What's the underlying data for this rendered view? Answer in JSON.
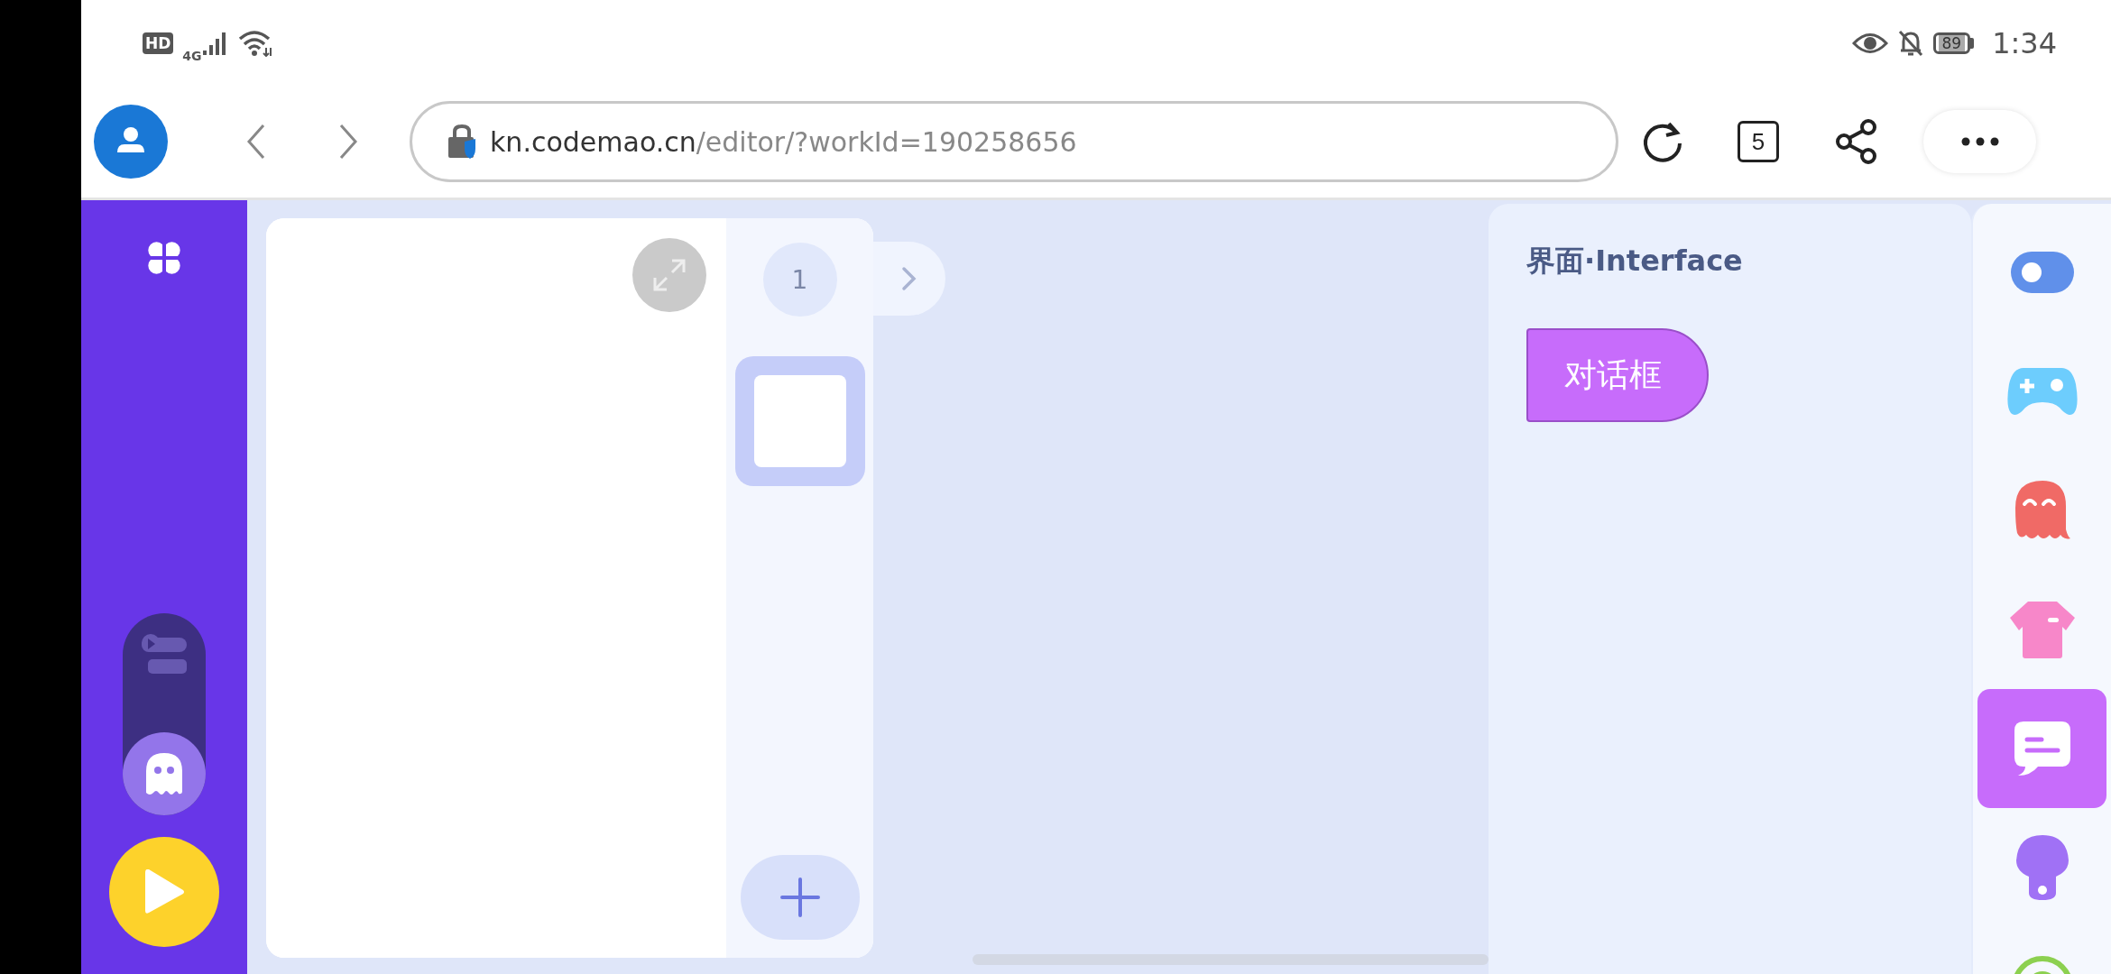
{
  "status_bar": {
    "network_badges": [
      "HD",
      "4G"
    ],
    "battery": "89",
    "time": "1:34"
  },
  "browser": {
    "address": {
      "host": "kn.codemao.cn",
      "path": "/editor/?workId=190258656"
    },
    "tab_count": "5"
  },
  "sidebar": {
    "modes": [
      {
        "kind": "code",
        "selected": false
      },
      {
        "kind": "sprite",
        "selected": true
      }
    ]
  },
  "stage": {
    "page_number": "1"
  },
  "block_panel": {
    "title": "界面·Interface",
    "blocks": [
      {
        "label": "对话框"
      }
    ]
  },
  "categories": [
    {
      "kind": "toggle",
      "selected": false
    },
    {
      "kind": "gamepad",
      "selected": false
    },
    {
      "kind": "ghost",
      "selected": false
    },
    {
      "kind": "shirt",
      "selected": false
    },
    {
      "kind": "chat",
      "selected": true
    },
    {
      "kind": "bulb",
      "selected": false
    },
    {
      "kind": "ring",
      "selected": false
    }
  ]
}
